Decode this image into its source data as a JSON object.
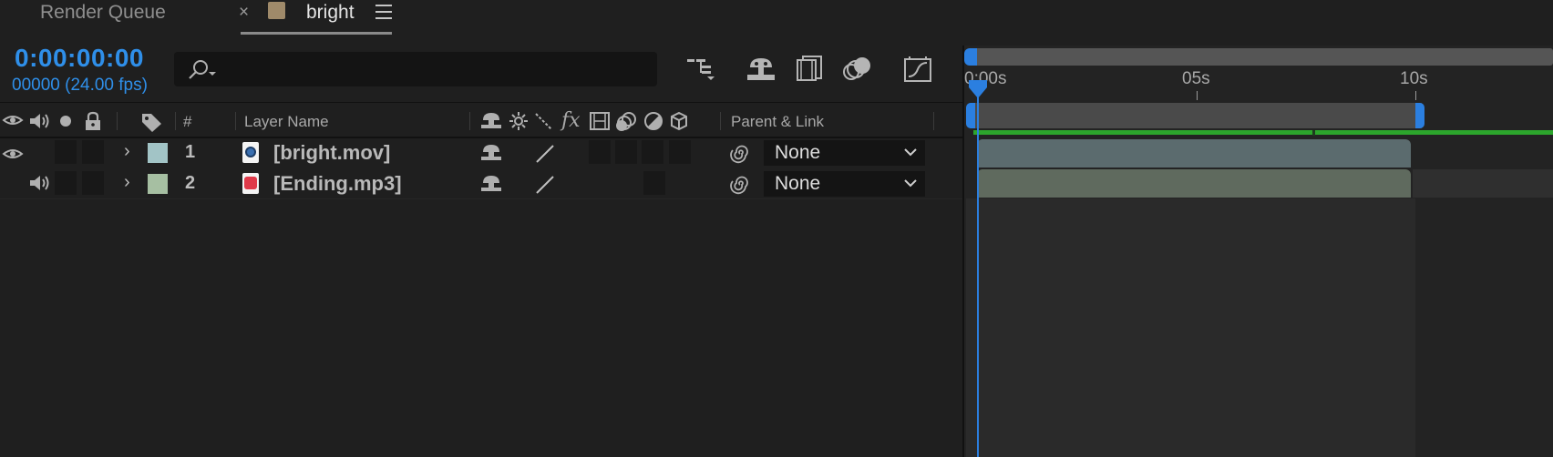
{
  "tabs": {
    "render_queue": "Render Queue",
    "close_symbol": "×",
    "active": "bright",
    "active_swatch": "#9f8a6a"
  },
  "header": {
    "timecode": "0:00:00:00",
    "frames": "00000 (24.00 fps)"
  },
  "columns": {
    "number": "#",
    "layer_name": "Layer Name",
    "fx": "fx",
    "parent_link": "Parent & Link"
  },
  "layers": [
    {
      "number": "1",
      "name": "[bright.mov]",
      "label_color": "#a2c4c6",
      "parent": "None",
      "type": "video"
    },
    {
      "number": "2",
      "name": "[Ending.mp3]",
      "label_color": "#a6bfa2",
      "parent": "None",
      "type": "audio"
    }
  ],
  "timeline": {
    "ruler_labels": [
      "0:00s",
      "05s",
      "10s"
    ],
    "accent": "#2b7fe0",
    "render_bar": "#2ca52c"
  }
}
